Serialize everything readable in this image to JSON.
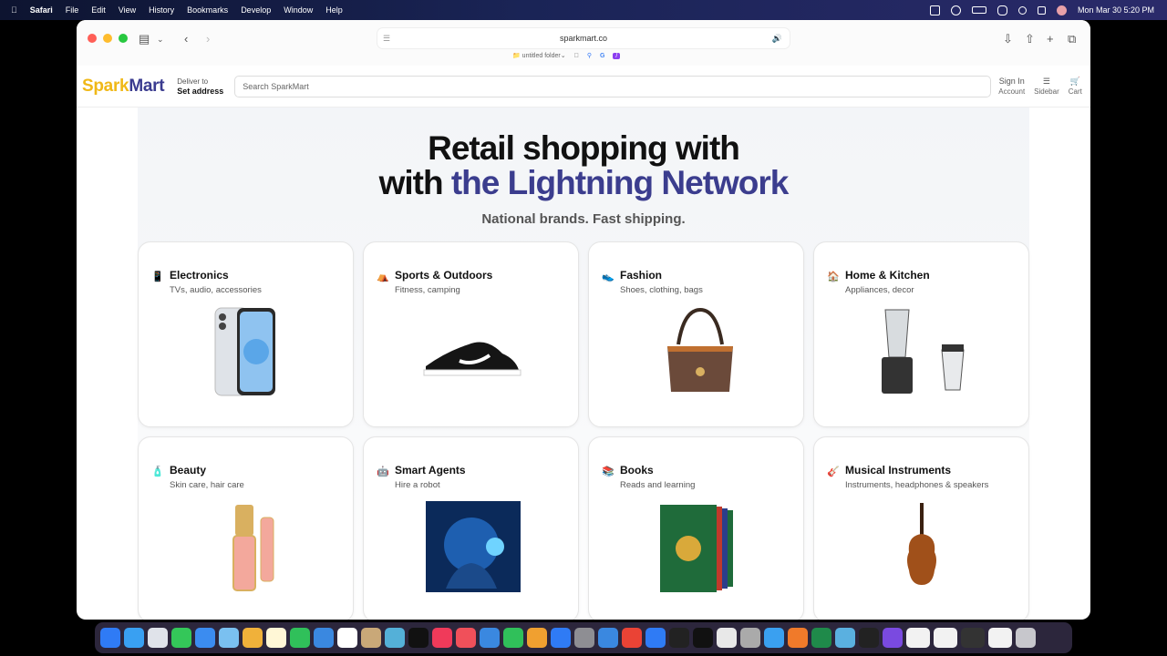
{
  "menubar": {
    "app": "Safari",
    "items": [
      "File",
      "Edit",
      "View",
      "History",
      "Bookmarks",
      "Develop",
      "Window",
      "Help"
    ],
    "datetime": "Mon Mar 30  5:20 PM"
  },
  "browser": {
    "url": "sparkmart.co",
    "favorites": [
      "untitled folder"
    ]
  },
  "header": {
    "logo_a": "Spark",
    "logo_b": "Mart",
    "deliver_label": "Deliver to",
    "deliver_value": "Set address",
    "search_placeholder": "Search SparkMart",
    "signin_top": "Sign In",
    "signin_bottom": "Account",
    "sidebar_label": "Sidebar",
    "cart_label": "Cart"
  },
  "hero": {
    "line1": "Retail shopping with",
    "line2a": "with ",
    "line2b": "the Lightning Network",
    "subtitle": "National brands. Fast shipping."
  },
  "categories": [
    {
      "title": "Electronics",
      "subtitle": "TVs, audio, accessories",
      "icon": "phone-icon"
    },
    {
      "title": "Sports & Outdoors",
      "subtitle": "Fitness, camping",
      "icon": "tent-icon"
    },
    {
      "title": "Fashion",
      "subtitle": "Shoes, clothing, bags",
      "icon": "shoe-icon"
    },
    {
      "title": "Home & Kitchen",
      "subtitle": "Appliances, decor",
      "icon": "house-icon"
    },
    {
      "title": "Beauty",
      "subtitle": "Skin care, hair care",
      "icon": "lotion-icon"
    },
    {
      "title": "Smart Agents",
      "subtitle": "Hire a robot",
      "icon": "robot-icon"
    },
    {
      "title": "Books",
      "subtitle": "Reads and learning",
      "icon": "books-icon"
    },
    {
      "title": "Musical Instruments",
      "subtitle": "Instruments, headphones & speakers",
      "icon": "guitar-icon"
    }
  ],
  "colors": {
    "accent": "#3b3d8e",
    "logo_yellow": "#f0b817"
  }
}
